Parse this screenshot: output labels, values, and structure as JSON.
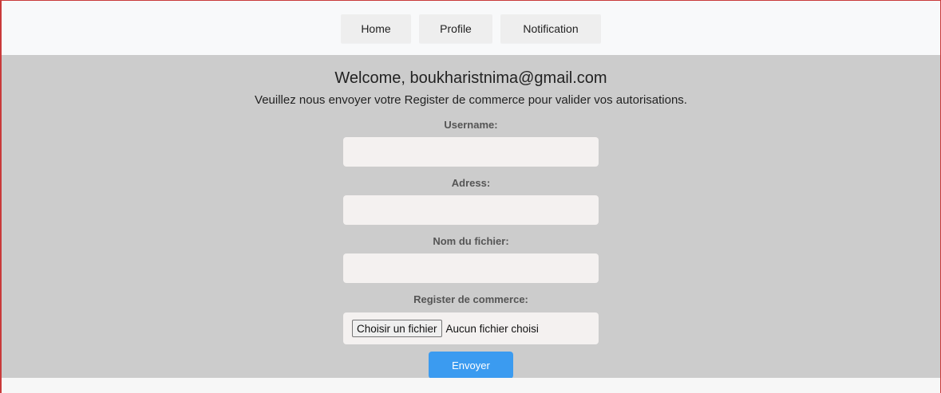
{
  "nav": {
    "items": [
      {
        "label": "Home"
      },
      {
        "label": "Profile"
      },
      {
        "label": "Notification"
      }
    ]
  },
  "main": {
    "welcome": "Welcome, boukharistnima@gmail.com",
    "instructions": "Veuillez nous envoyer votre Register de commerce pour valider vos autorisations."
  },
  "form": {
    "username_label": "Username:",
    "username_value": "",
    "address_label": "Adress:",
    "address_value": "",
    "filename_label": "Nom du fichier:",
    "filename_value": "",
    "register_label": "Register de commerce:",
    "file_button_label": "Choisir un fichier",
    "file_status": "Aucun fichier choisi",
    "submit_label": "Envoyer"
  },
  "colors": {
    "accent": "#3b9bf0",
    "main_background": "#cccccc",
    "input_background": "#f4f1f0",
    "window_border": "#c93a3a"
  }
}
